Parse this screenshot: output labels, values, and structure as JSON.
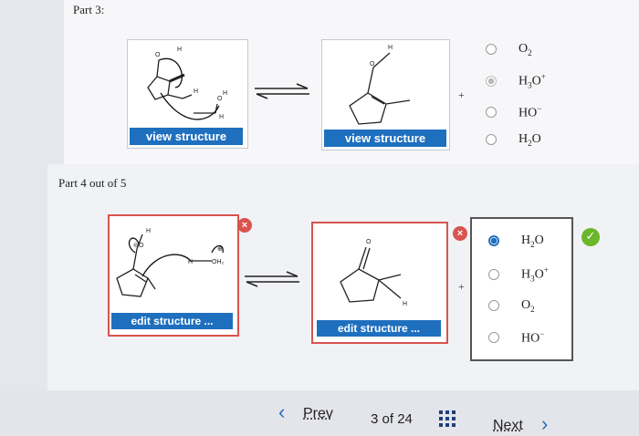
{
  "part3": {
    "heading": "Part 3:",
    "view_label": "view structure",
    "plus": "+",
    "options": [
      {
        "label": "O",
        "sub": "2",
        "sup": "",
        "state": "none"
      },
      {
        "label": "H",
        "sub": "3",
        "rest": "O",
        "sup": "+",
        "state": "selected-grey"
      },
      {
        "label": "HO",
        "sub": "",
        "sup": "−",
        "state": "none"
      },
      {
        "label": "H",
        "sub": "2",
        "rest": "O",
        "sup": "",
        "state": "none"
      }
    ]
  },
  "part4": {
    "heading": "Part 4 out of 5",
    "edit_label": "edit structure ...",
    "plus": "+",
    "x_mark": "×",
    "check_mark": "✓",
    "options": [
      {
        "label": "H",
        "sub": "2",
        "rest": "O",
        "sup": "",
        "state": "selected"
      },
      {
        "label": "H",
        "sub": "3",
        "rest": "O",
        "sup": "+",
        "state": "none"
      },
      {
        "label": "O",
        "sub": "2",
        "sup": "",
        "state": "none"
      },
      {
        "label": "HO",
        "sub": "",
        "sup": "−",
        "state": "none"
      }
    ]
  },
  "footer": {
    "prev_chevron": "‹",
    "prev_label": "Prev",
    "page_current": "3",
    "page_of": "of",
    "page_total": "24",
    "next_label": "Next",
    "next_chevron": "›",
    "grid_icon": "grid-icon"
  },
  "colors": {
    "accent": "#1f6fbf",
    "error": "#d9534f",
    "success": "#6ab72b"
  }
}
